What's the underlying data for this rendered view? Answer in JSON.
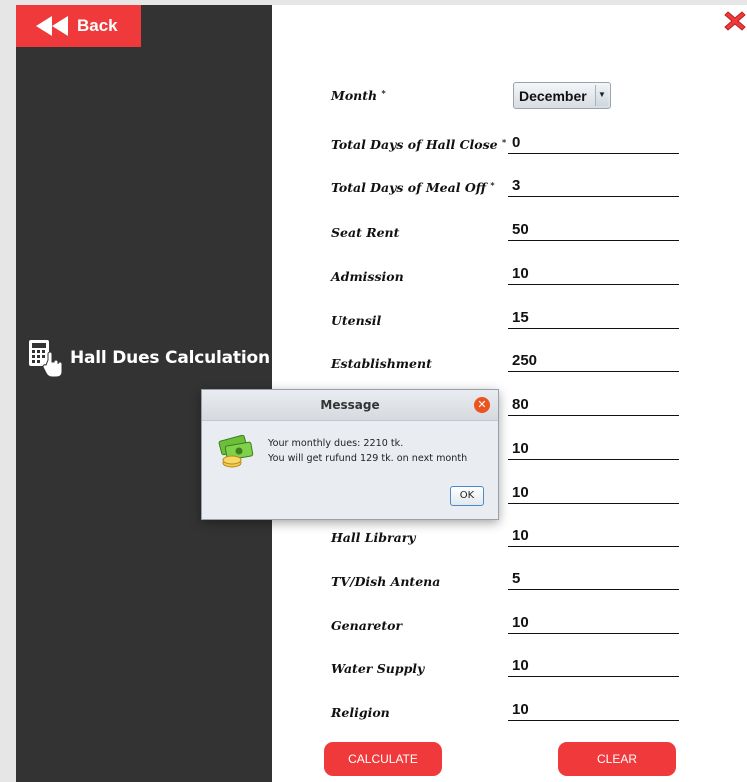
{
  "sidebar": {
    "back_label": "Back",
    "app_title": "Hall Dues Calculation"
  },
  "form": {
    "month_label": "Month",
    "month_value": "December",
    "fields": [
      {
        "label": "Total Days of Hall Close",
        "value": "0"
      },
      {
        "label": "Total Days of Meal Off",
        "value": "3"
      },
      {
        "label": "Seat Rent",
        "value": "50"
      },
      {
        "label": "Admission",
        "value": "10"
      },
      {
        "label": "Utensil",
        "value": "15"
      },
      {
        "label": "Establishment",
        "value": "250"
      },
      {
        "label": "",
        "value": "80"
      },
      {
        "label": "",
        "value": "10"
      },
      {
        "label": "",
        "value": "10"
      },
      {
        "label": "Hall Library",
        "value": "10"
      },
      {
        "label": "TV/Dish Antena",
        "value": "5"
      },
      {
        "label": "Genaretor",
        "value": "10"
      },
      {
        "label": "Water Supply",
        "value": "10"
      },
      {
        "label": "Religion",
        "value": "10"
      }
    ],
    "calculate_label": "CALCULATE",
    "clear_label": "CLEAR"
  },
  "dialog": {
    "title": "Message",
    "line1": "Your monthly dues: 2210 tk.",
    "line2": "You will get rufund 129 tk. on next month",
    "ok_label": "OK"
  },
  "colors": {
    "accent_red": "#f0393b",
    "sidebar_bg": "#333333",
    "content_bg": "#ffffff"
  },
  "icons": {
    "back": "double-left-arrow-icon",
    "app": "calculator-hand-icon",
    "close": "red-x-icon",
    "dialog_close": "close-circle-icon",
    "dialog_message": "money-icon"
  }
}
